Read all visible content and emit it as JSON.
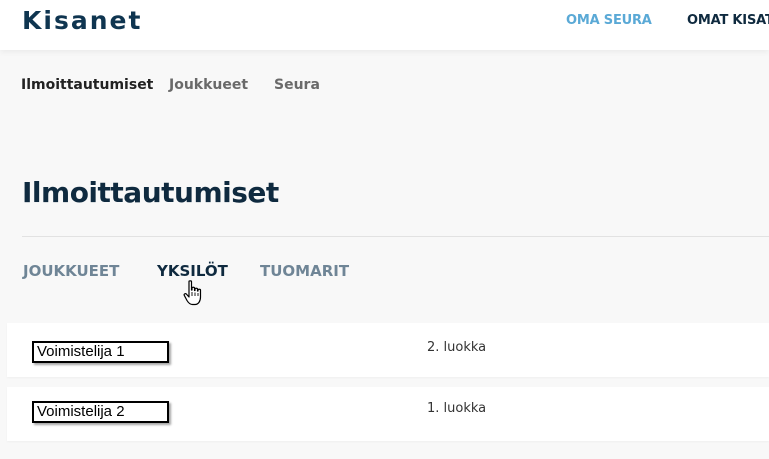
{
  "header": {
    "logo": "Kisanet",
    "nav": [
      "OMA SEURA",
      "OMAT KISAT"
    ]
  },
  "subnav": {
    "items": [
      "Ilmoittautumiset",
      "Joukkueet",
      "Seura"
    ],
    "active": "Ilmoittautumiset"
  },
  "main": {
    "title": "Ilmoittautumiset",
    "tabs": [
      "JOUKKUEET",
      "YKSILÖT",
      "TUOMARIT"
    ],
    "active_tab": "YKSILÖT",
    "rows": [
      {
        "name": "Voimistelija 1",
        "class": "2. luokka"
      },
      {
        "name": "Voimistelija 2",
        "class": "1. luokka"
      }
    ]
  },
  "colors": {
    "brand": "#0f3550",
    "accent": "#5aa9d6",
    "muted_tab": "#6f8596"
  },
  "icons": {
    "cursor": "hand-pointer-icon"
  }
}
